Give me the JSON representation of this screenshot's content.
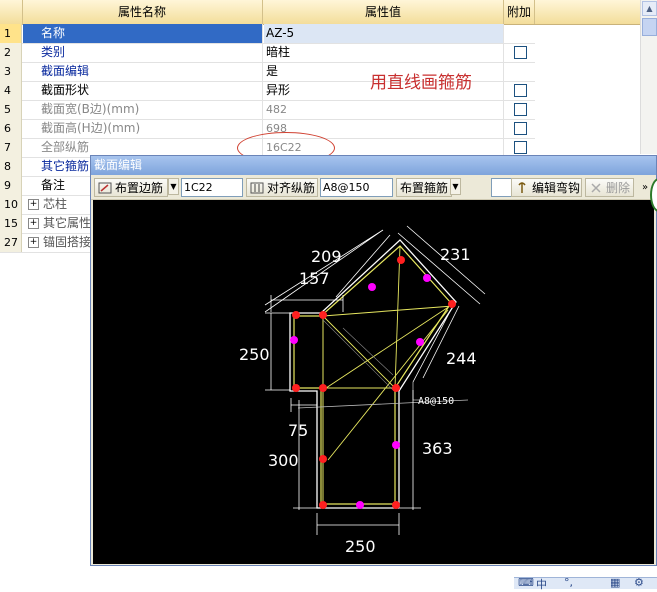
{
  "grid": {
    "headers": {
      "name": "属性名称",
      "value": "属性值",
      "extra": "附加"
    },
    "rows": [
      {
        "idx": "1",
        "name": "名称",
        "value": "AZ-5",
        "checkbox": false,
        "style": "sel"
      },
      {
        "idx": "2",
        "name": "类别",
        "value": "暗柱",
        "checkbox": true,
        "style": "blue"
      },
      {
        "idx": "3",
        "name": "截面编辑",
        "value": "是",
        "checkbox": false,
        "style": "blue"
      },
      {
        "idx": "4",
        "name": "截面形状",
        "value": "异形",
        "checkbox": true,
        "style": "normal"
      },
      {
        "idx": "5",
        "name": "截面宽(B边)(mm)",
        "value": "482",
        "checkbox": true,
        "style": "gray"
      },
      {
        "idx": "6",
        "name": "截面高(H边)(mm)",
        "value": "698",
        "checkbox": true,
        "style": "gray"
      },
      {
        "idx": "7",
        "name": "全部纵筋",
        "value": "16C22",
        "checkbox": true,
        "style": "gray"
      },
      {
        "idx": "8",
        "name": "其它箍筋",
        "value": "",
        "checkbox": false,
        "style": "blue"
      },
      {
        "idx": "9",
        "name": "备注",
        "value": "",
        "checkbox": false,
        "style": "normal"
      },
      {
        "idx": "10",
        "name": "芯柱",
        "value": "",
        "checkbox": false,
        "style": "group"
      },
      {
        "idx": "15",
        "name": "其它属性",
        "value": "",
        "checkbox": false,
        "style": "group"
      },
      {
        "idx": "27",
        "name": "锚固搭接",
        "value": "",
        "checkbox": false,
        "style": "group"
      }
    ],
    "annotation": "用直线画箍筋"
  },
  "editor": {
    "title": "截面编辑",
    "toolbar": {
      "place_edge_rebar": "布置边筋",
      "edge_rebar_value": "1C22",
      "align_long_rebar": "对齐纵筋",
      "stirrup_value": "A8@150",
      "place_stirrup": "布置箍筋",
      "edit_hook": "编辑弯钩",
      "delete": "删除"
    },
    "drawing": {
      "dims": {
        "d209": "209",
        "d231": "231",
        "d157": "157",
        "d250_left": "250",
        "d244": "244",
        "d75": "75",
        "d300": "300",
        "d363": "363",
        "d250_bottom": "250"
      },
      "stirrup_label": "A8@150",
      "colors": {
        "background": "#000000",
        "outline": "#ffffff",
        "rebar_corner": "#ff2020",
        "rebar_edge": "#ff00ff",
        "stirrup": "#e8e860"
      }
    }
  },
  "tray": {
    "char": "中"
  }
}
